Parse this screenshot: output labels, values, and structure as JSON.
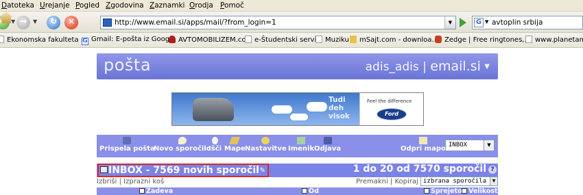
{
  "browser": {
    "menu": [
      "Datoteka",
      "Urejanje",
      "Pogled",
      "Zgodovina",
      "Zaznamki",
      "Orodja",
      "Pomoč"
    ],
    "url": "http://www.email.si/apps/mail/?from_login=1",
    "search_value": "avtoplin srbija",
    "bookmarks": [
      "Ekonomska fakulteta ...",
      "Gmail: E-pošta iz Googla",
      "AVTOMOBILIZEM.co...",
      "e-Študentski servis",
      "Muziku:",
      "mSajt.com - downloa...",
      "Zedge | Free ringtones,...",
      "www.planetamuzik"
    ]
  },
  "header": {
    "logo": "pošta",
    "user": "adis_adis",
    "separator": "|",
    "brand": "email.si"
  },
  "ad": {
    "slogan_lines": [
      "Tudi",
      "deh",
      "visok"
    ],
    "tagline": "Feel the difference",
    "brand": "Ford"
  },
  "toolbar": {
    "items": [
      "Prispela pošta",
      "Novo sporočilo",
      "Išči",
      "Mape",
      "Nastavitve",
      "Imenik",
      "Odjava"
    ],
    "open_folder_label": "Odpri mapo",
    "folder_value": "INBOX"
  },
  "inbox": {
    "title": "INBOX - 7569 novih sporočil",
    "counter": "1 do 20 od 7570 sporočil",
    "help": "?"
  },
  "actions": {
    "left": "Izbriši | Izprazni koš",
    "right": "Premakni | Kopiraj",
    "select_value": "izbrana sporočila v"
  },
  "columns": {
    "subject": "Zadeva",
    "from": "Od",
    "received": "Sprejeto",
    "size": "Velikost"
  }
}
